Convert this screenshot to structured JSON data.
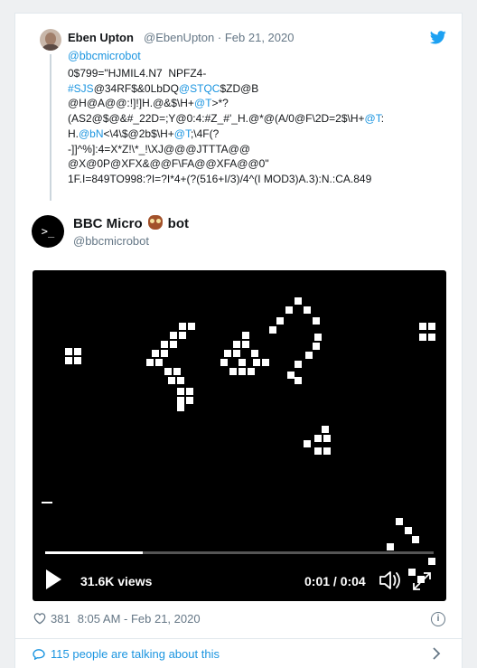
{
  "parent_tweet": {
    "display_name": "Eben Upton",
    "handle": "@EbenUpton",
    "separator": "·",
    "date": "Feb 21, 2020",
    "reply_to": "@bbcmicrobot",
    "code_lines": [
      "0$799=\"HJMIL4.N7  NPFZ4-",
      "#SJS@34RF$&0LbDQ@STQC$ZD@B",
      "@H@A@@:!]!]H.@&$\\H+@T>*?",
      "(AS2@$@&#_22D=;Y@0:4:#Z_#'_H.@*@(A/0@F\\2D=2$\\H+@T:",
      "H.@bN<\\4\\$@2b$\\H+@T;\\4F(?",
      "-]]^%]:4=X*Z!\\*_!\\XJ@@@JTTTA@@",
      "@X@0P@XFX&@@F\\FA@@XFA@@0\"",
      "1F.I=849TO998:?I=?I*4+(?(516+I/3)/4^(I MOD3)A.3):N.:CA.849"
    ]
  },
  "bot_tweet": {
    "display_name_before": "BBC Micro",
    "display_name_after": "bot",
    "handle": "@bbcmicrobot",
    "avatar_text": ">_",
    "owl_emoji": "owl"
  },
  "video": {
    "views": "31.6K views",
    "time": "0:01 / 0:04",
    "progress": 0.25
  },
  "footer": {
    "likes": "381",
    "timestamp": "8:05 AM - Feb 21, 2020",
    "talking": "115 people are talking about this",
    "info_glyph": "i"
  },
  "colors": {
    "link": "#1b95e0",
    "muted": "#657786",
    "text": "#14171a",
    "brand": "#1da1f2"
  }
}
